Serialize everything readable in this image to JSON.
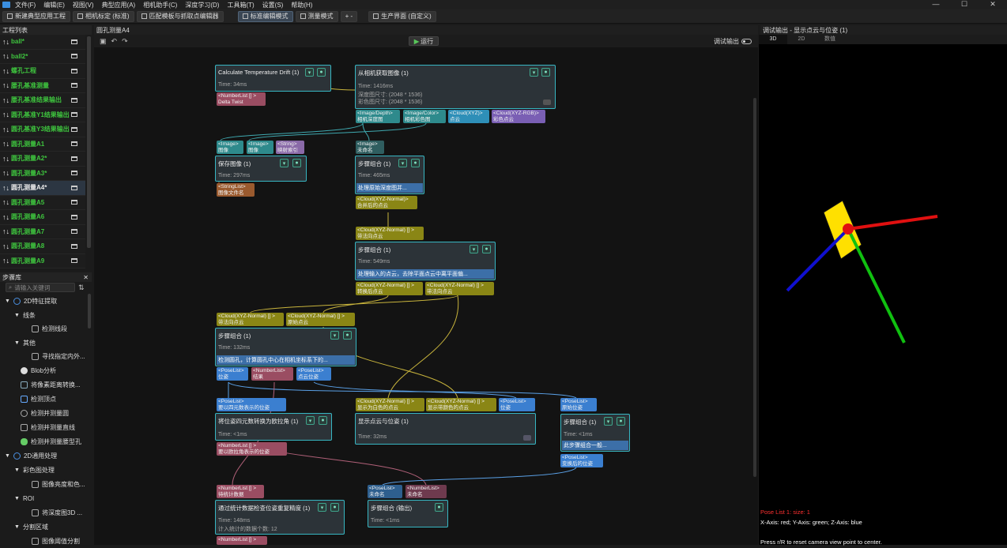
{
  "menu": [
    "文件(F)",
    "编辑(E)",
    "视图(V)",
    "典型应用(A)",
    "相机助手(C)",
    "深度学习(D)",
    "工具箱(T)",
    "设置(S)",
    "帮助(H)"
  ],
  "toolbar": {
    "b1": "新建典型应用工程",
    "b2": "相机标定 (标准)",
    "b3": "匹配模板与抓取点编辑器",
    "b4": "标准编辑模式",
    "b5": "测量模式",
    "b6": "+ -",
    "b7": "生产界面 (自定义)"
  },
  "project_panel": {
    "title": "工程列表",
    "items": [
      "ball*",
      "ball2*",
      "螺孔工程",
      "腰孔基准测量",
      "腰孔基准结果输出",
      "圆孔基准Y1结果输出",
      "圆孔基准Y3结果输出",
      "圆孔测量A1",
      "圆孔测量A2*",
      "圆孔测量A3*",
      "圆孔测量A4*",
      "圆孔测量A5",
      "圆孔测量A6",
      "圆孔测量A7",
      "圆孔测量A8",
      "圆孔测量A9"
    ]
  },
  "step_lib": {
    "title": "步骤库",
    "search_placeholder": "请输入关键词",
    "items": [
      "2D特征提取",
      "线条",
      "检测线段",
      "其他",
      "寻找指定内外...",
      "Blob分析",
      "将像素距离转换...",
      "检测顶点",
      "检测并测量圆",
      "检测并测量直线",
      "检测并测量腰型孔",
      "2D通用处理",
      "彩色图处理",
      "图像亮度和色...",
      "ROI",
      "将深度图3D ...",
      "分割区域",
      "图像阈值分割"
    ]
  },
  "editor": {
    "tab": "圆孔测量A4",
    "run": "运行",
    "debug_output": "调试输出"
  },
  "nodes": {
    "n1": {
      "title": "Calculate Temperature Drift (1)",
      "time": "Time: 34ms"
    },
    "n2": {
      "title": "从相机获取图像 (1)",
      "time": "Time: 1416ms",
      "l2": "深度图尺寸: (2048 * 1536)",
      "l3": "彩色图尺寸: (2048 * 1536)"
    },
    "n3": {
      "title": "保存图像 (1)",
      "time": "Time: 297ms"
    },
    "n4": {
      "title": "步骤组合 (1)",
      "time": "Time: 465ms",
      "desc": "处理原始深度图并..."
    },
    "n5": {
      "title": "步骤组合 (1)",
      "time": "Time: 549ms",
      "desc": "处理输入的点云，去除平面点云中离平面偏..."
    },
    "n6": {
      "title": "步骤组合 (1)",
      "time": "Time: 132ms",
      "desc": "检测圆孔，计算圆孔中心在相机坐标系下的..."
    },
    "n7": {
      "title": "将位姿四元数转换为欧拉角 (1)",
      "time": "Time: <1ms"
    },
    "n8": {
      "title": "显示点云与位姿 (1)",
      "time": "Time: 32ms"
    },
    "n9": {
      "title": "步骤组合 (1)",
      "time": "Time: <1ms",
      "desc": "此步骤组合一般..."
    },
    "n10": {
      "title": "通过统计数据检查位姿重复精度 (1)",
      "time": "Time: 148ms",
      "l2": "计入统计的数据个数: 12"
    },
    "n11": {
      "title": "步骤组合 (输出)",
      "time": "Time: <1ms"
    }
  },
  "ports": {
    "a1": "<NumberList [] >",
    "a2": "Delta Twist",
    "b1": "<Image/Depth>",
    "b2": "相机深度图",
    "b3": "<Image/Color>",
    "b4": "相机彩色图",
    "b5": "<Cloud(XYZ)>",
    "b6": "点云",
    "b7": "<Cloud(XYZ-RGB)>",
    "b8": "彩色点云",
    "c1": "<Image>",
    "c2": "图像",
    "c3": "<Image>",
    "c4": "图像",
    "c5": "<String>",
    "c6": "映射索引",
    "c7": "<StringList>",
    "c8": "图像文件名",
    "d1": "<Image>",
    "d2": "未命名",
    "d3": "<Cloud(XYZ-Normal)>",
    "d4": "合并后的点云",
    "e1": "<Cloud(XYZ-Normal) [] >",
    "e2": "带法向点云",
    "e3": "<Cloud(XYZ-Normal) [] >",
    "e4": "转换后点云",
    "e5": "<Cloud(XYZ-Normal) [] >",
    "e6": "带法向点云",
    "f1": "<Cloud(XYZ-Normal) [] >",
    "f2": "带法向点云",
    "f3": "<Cloud(XYZ-Normal) [] >",
    "f4": "原始点云",
    "g1": "<PoseList>",
    "g2": "位姿",
    "g3": "<NumberList>",
    "g4": "结果",
    "g5": "<PoseList>",
    "g6": "点云位姿",
    "h1": "<PoseList>",
    "h2": "要以四元数表示的位姿",
    "h3": "<NumberList [] >",
    "h4": "要以欧拉角表示的位姿",
    "i1": "<Cloud(XYZ-Normal) [] >",
    "i2": "显示为白色的点云",
    "i3": "<Cloud(XYZ-Normal) [] >",
    "i4": "显示带颜色的点云",
    "i5": "<PoseList>",
    "i6": "位姿",
    "j1": "<PoseList>",
    "j2": "原始位姿",
    "j3": "<PoseList>",
    "j4": "变换后的位姿",
    "k1": "<NumberList [] >",
    "k2": "待统计数据",
    "k3": "<NumberList [] >",
    "m1": "<PoseList>",
    "m2": "未命名",
    "m3": "<NumberList>",
    "m4": "未命名"
  },
  "viewer": {
    "title": "调试输出 - 显示点云与位姿 (1)",
    "tabs": [
      "3D",
      "2D",
      "数值"
    ],
    "pose_info": "Pose List 1: size: 1",
    "axes_info": "X-Axis: red; Y-Axis: green; Z-Axis: blue",
    "reset_info": "Press r/R to reset camera view point to center."
  },
  "colors": {
    "node_border": "#37b6c2",
    "desc_bg": "#3c6fa8",
    "project_green": "#3ec43e",
    "axis_x": "#e01010",
    "axis_y": "#10c010",
    "axis_z": "#1010d0",
    "plane": "#ffe000",
    "pose_text": "#ff3030"
  }
}
